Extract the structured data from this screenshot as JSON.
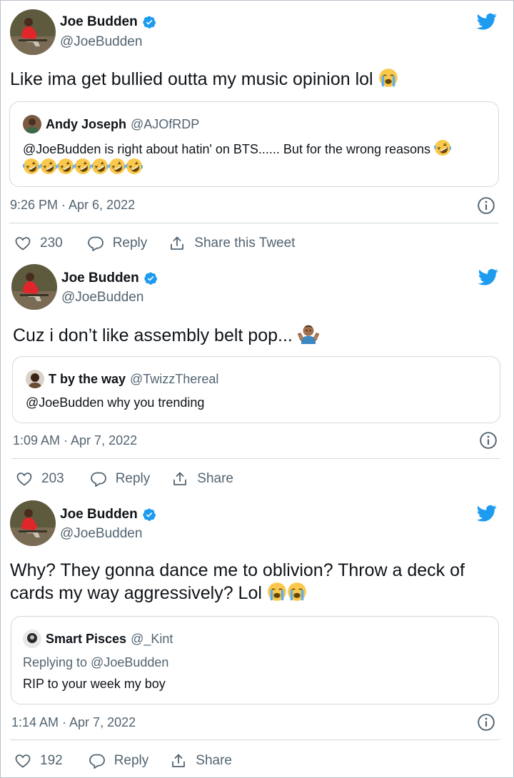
{
  "tweets": [
    {
      "name": "Joe Budden",
      "handle": "@JoeBudden",
      "text": "Like ima get bullied outta my music opinion lol",
      "quote": {
        "name": "Andy Joseph",
        "handle": "@AJOfRDP",
        "text": "@JoeBudden is right about hatin' on BTS...... But for the wrong reasons"
      },
      "timestamp": "9:26 PM · Apr 6, 2022",
      "likes": "230",
      "reply_label": "Reply",
      "share_label": "Share this Tweet"
    },
    {
      "name": "Joe Budden",
      "handle": "@JoeBudden",
      "text": "Cuz i don’t like assembly belt pop...",
      "quote": {
        "name": "T by the way",
        "handle": "@TwizzThereal",
        "text": "@JoeBudden why you trending"
      },
      "timestamp": "1:09 AM · Apr 7, 2022",
      "likes": "203",
      "reply_label": "Reply",
      "share_label": "Share"
    },
    {
      "name": "Joe Budden",
      "handle": "@JoeBudden",
      "text_line1": "Why? They gonna dance me to oblivion? Throw a deck of",
      "text_line2": "cards my way aggressively? Lol",
      "quote": {
        "name": "Smart Pisces",
        "handle": "@_Kint",
        "replying": "Replying to @JoeBudden",
        "text": "RIP to your week my boy"
      },
      "timestamp": "1:14 AM · Apr 7, 2022",
      "likes": "192",
      "reply_label": "Reply",
      "share_label": "Share"
    }
  ],
  "colors": {
    "twitter_blue": "#1d9bf0",
    "secondary_text": "#536471",
    "border": "#cfd9de"
  }
}
